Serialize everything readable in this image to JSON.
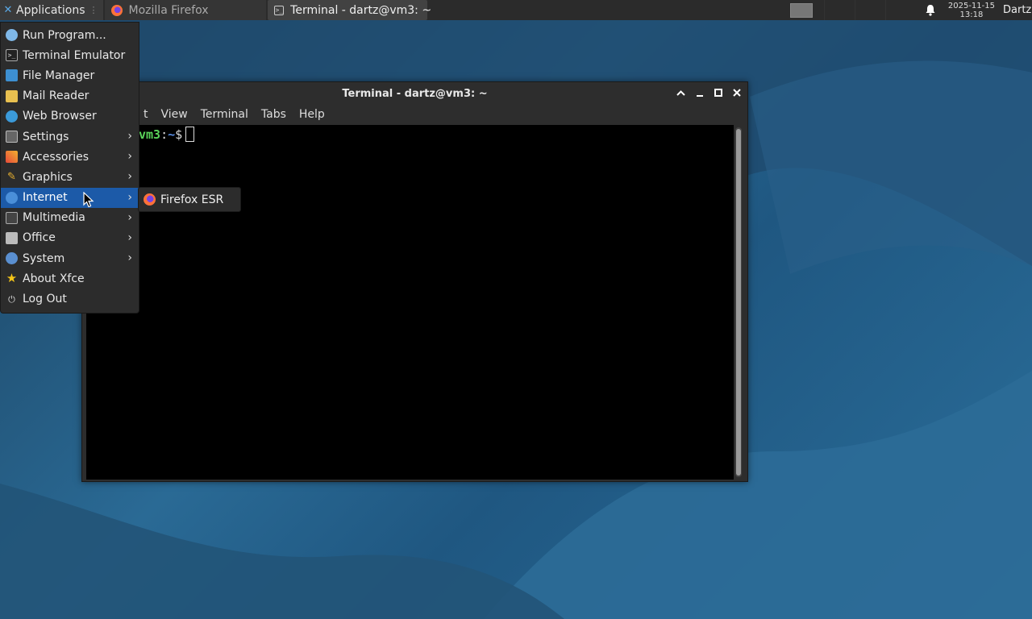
{
  "panel": {
    "applications_label": "Applications",
    "tasks": [
      {
        "label": "Mozilla Firefox",
        "icon": "firefox-icon"
      },
      {
        "label": "Terminal - dartz@vm3: ~",
        "icon": "terminal-icon"
      }
    ],
    "clock_date": "2025-11-15",
    "clock_time": "13:18",
    "user": "Dartz"
  },
  "terminal": {
    "title": "Terminal - dartz@vm3: ~",
    "menu": [
      "t",
      "View",
      "Terminal",
      "Tabs",
      "Help"
    ],
    "prompt_host": "vm3",
    "prompt_sep": ":",
    "prompt_path": "~",
    "prompt_symbol": "$"
  },
  "app_menu": {
    "items": [
      {
        "label": "Run Program...",
        "icon": "search-icon",
        "has_submenu": false
      },
      {
        "label": "Terminal Emulator",
        "icon": "terminal-icon",
        "has_submenu": false
      },
      {
        "label": "File Manager",
        "icon": "file-manager-icon",
        "has_submenu": false
      },
      {
        "label": "Mail Reader",
        "icon": "mail-icon",
        "has_submenu": false
      },
      {
        "label": "Web Browser",
        "icon": "web-browser-icon",
        "has_submenu": false
      },
      {
        "label": "Settings",
        "icon": "settings-icon",
        "has_submenu": true
      },
      {
        "label": "Accessories",
        "icon": "accessories-icon",
        "has_submenu": true
      },
      {
        "label": "Graphics",
        "icon": "graphics-icon",
        "has_submenu": true
      },
      {
        "label": "Internet",
        "icon": "internet-icon",
        "has_submenu": true,
        "active": true
      },
      {
        "label": "Multimedia",
        "icon": "multimedia-icon",
        "has_submenu": true
      },
      {
        "label": "Office",
        "icon": "office-icon",
        "has_submenu": true
      },
      {
        "label": "System",
        "icon": "system-icon",
        "has_submenu": true
      },
      {
        "label": "About Xfce",
        "icon": "star-icon",
        "has_submenu": false
      },
      {
        "label": "Log Out",
        "icon": "logout-icon",
        "has_submenu": false
      }
    ]
  },
  "submenu": {
    "items": [
      {
        "label": "Firefox ESR",
        "icon": "firefox-icon"
      }
    ]
  },
  "colors": {
    "menu_highlight": "#1c5aa8",
    "prompt_host": "#5ad35a",
    "prompt_path": "#5a8fe6"
  }
}
